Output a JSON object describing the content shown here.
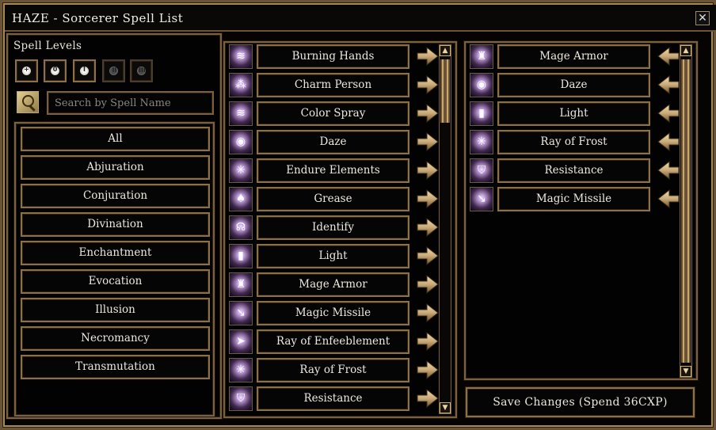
{
  "window": {
    "title": "HAZE - Sorcerer Spell List",
    "close_glyph": "✕"
  },
  "filters": {
    "spell_levels_label": "Spell Levels",
    "levels": [
      {
        "glyph": "+",
        "active": true
      },
      {
        "glyph": "0",
        "active": true
      },
      {
        "glyph": "I",
        "active": true
      },
      {
        "glyph": "II",
        "active": false
      },
      {
        "glyph": "III",
        "active": false
      }
    ],
    "search": {
      "placeholder": "Search by Spell Name",
      "value": ""
    },
    "schools": [
      "All",
      "Abjuration",
      "Conjuration",
      "Divination",
      "Enchantment",
      "Evocation",
      "Illusion",
      "Necromancy",
      "Transmutation"
    ]
  },
  "available_spells": [
    {
      "name": "Burning Hands",
      "icon": "hand-flames-icon",
      "glyph": "≋"
    },
    {
      "name": "Charm Person",
      "icon": "charm-person-icon",
      "glyph": "⁂"
    },
    {
      "name": "Color Spray",
      "icon": "color-spray-icon",
      "glyph": "≋"
    },
    {
      "name": "Daze",
      "icon": "daze-eye-icon",
      "glyph": "◉"
    },
    {
      "name": "Endure Elements",
      "icon": "shield-star-icon",
      "glyph": "✳"
    },
    {
      "name": "Grease",
      "icon": "grease-figure-icon",
      "glyph": "♠"
    },
    {
      "name": "Identify",
      "icon": "identify-face-icon",
      "glyph": "☊"
    },
    {
      "name": "Light",
      "icon": "light-pillar-icon",
      "glyph": "▮"
    },
    {
      "name": "Mage Armor",
      "icon": "mage-armor-icon",
      "glyph": "♜"
    },
    {
      "name": "Magic Missile",
      "icon": "magic-missile-icon",
      "glyph": "↘"
    },
    {
      "name": "Ray of Enfeeblement",
      "icon": "ray-enfeeblement-icon",
      "glyph": "➤"
    },
    {
      "name": "Ray of Frost",
      "icon": "ray-frost-icon",
      "glyph": "✳"
    },
    {
      "name": "Resistance",
      "icon": "resistance-shield-icon",
      "glyph": "⛉"
    }
  ],
  "known_spells": [
    {
      "name": "Mage Armor",
      "icon": "mage-armor-icon",
      "glyph": "♜"
    },
    {
      "name": "Daze",
      "icon": "daze-eye-icon",
      "glyph": "◉"
    },
    {
      "name": "Light",
      "icon": "light-pillar-icon",
      "glyph": "▮"
    },
    {
      "name": "Ray of Frost",
      "icon": "ray-frost-icon",
      "glyph": "✳"
    },
    {
      "name": "Resistance",
      "icon": "resistance-shield-icon",
      "glyph": "⛉"
    },
    {
      "name": "Magic Missile",
      "icon": "magic-missile-icon",
      "glyph": "↘"
    }
  ],
  "save_button": "Save Changes (Spend 36CXP)",
  "colors": {
    "gold_border": "#8c7048",
    "arrow_fill": "#c9aa78",
    "text": "#ece8de",
    "background": "#050505"
  }
}
